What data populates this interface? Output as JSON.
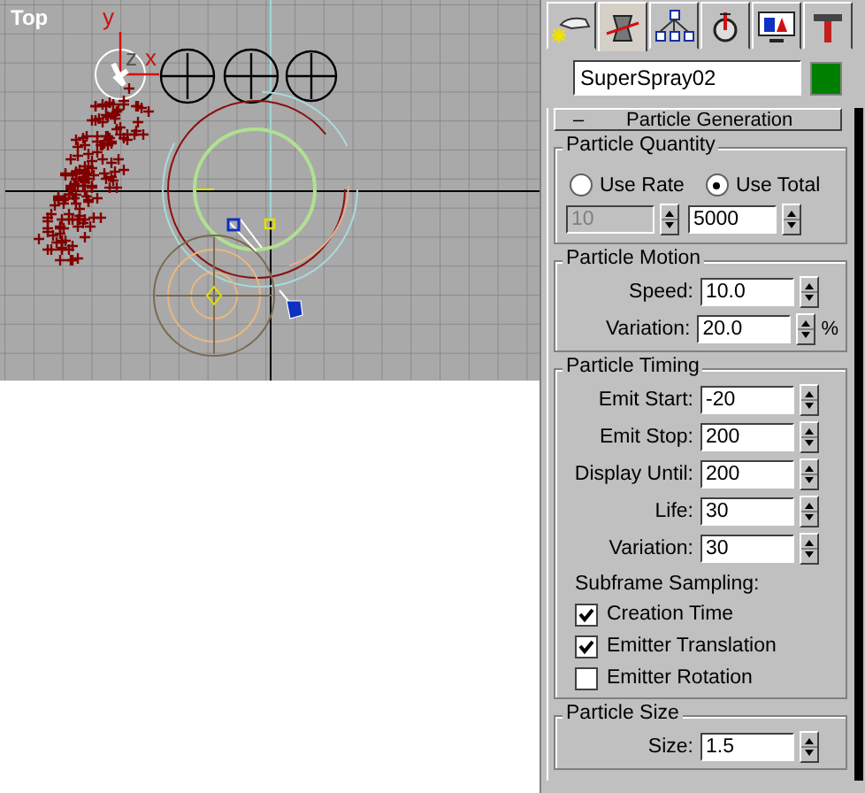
{
  "viewport": {
    "label": "Top",
    "axis_labels": [
      {
        "kind": "y",
        "text": "y"
      },
      {
        "kind": "z",
        "text": "z"
      },
      {
        "kind": "x",
        "text": "x"
      }
    ]
  },
  "command_panel": {
    "tabs": [
      {
        "kind": "create",
        "selected": false
      },
      {
        "kind": "modify",
        "selected": true
      },
      {
        "kind": "hierarchy",
        "selected": false
      },
      {
        "kind": "motion",
        "selected": false
      },
      {
        "kind": "display",
        "selected": false
      },
      {
        "kind": "utilities",
        "selected": false
      }
    ],
    "object": {
      "name": "SuperSpray02",
      "color": "#008000"
    },
    "rollout": {
      "toggle": "–",
      "title": "Particle Generation",
      "groups": [
        {
          "title": "Particle Quantity",
          "radios": [
            {
              "label": "Use Rate",
              "selected": false
            },
            {
              "label": "Use Total",
              "selected": true
            }
          ],
          "spinners": [
            {
              "value": "10",
              "disabled": true
            },
            {
              "value": "5000",
              "disabled": false
            }
          ]
        },
        {
          "title": "Particle Motion",
          "fields": [
            {
              "label": "Speed:",
              "value": "10.0"
            },
            {
              "label": "Variation:",
              "value": "20.0",
              "unit": "%"
            }
          ]
        },
        {
          "title": "Particle Timing",
          "fields": [
            {
              "label": "Emit Start:",
              "value": "-20"
            },
            {
              "label": "Emit Stop:",
              "value": "200"
            },
            {
              "label": "Display Until:",
              "value": "200"
            },
            {
              "label": "Life:",
              "value": "30"
            },
            {
              "label": "Variation:",
              "value": "30"
            }
          ],
          "note": "Subframe Sampling:",
          "checkboxes": [
            {
              "label": "Creation Time",
              "checked": true
            },
            {
              "label": "Emitter Translation",
              "checked": true
            },
            {
              "label": "Emitter Rotation",
              "checked": false
            }
          ]
        },
        {
          "title": "Particle Size",
          "fields": [
            {
              "label": "Size:",
              "value": "1.5"
            }
          ]
        }
      ]
    }
  }
}
